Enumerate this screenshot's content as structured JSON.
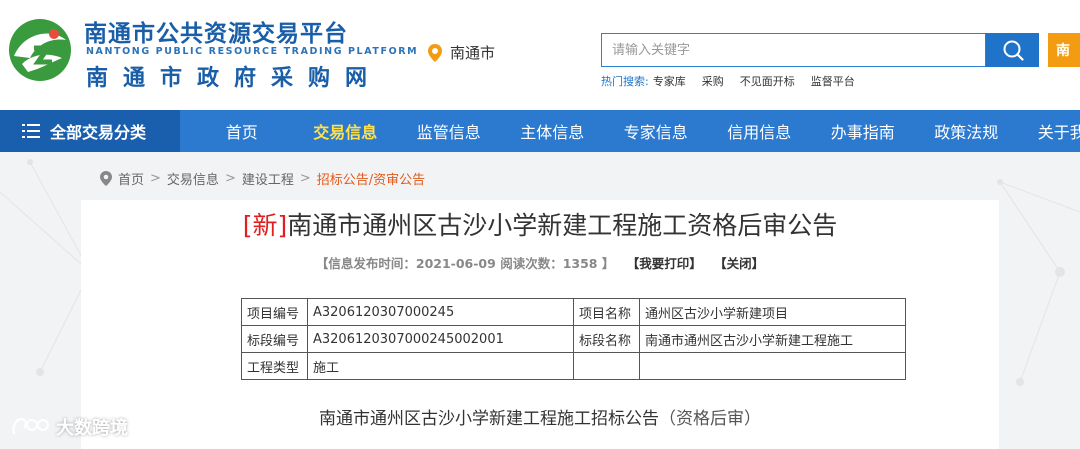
{
  "colors": {
    "brand_blue": "#1a5ea8",
    "nav_blue": "#2b7ad0",
    "nav_dark": "#1a5fae",
    "active_yellow": "#ffe04a",
    "accent_red": "#e02020",
    "accent_orange": "#f39c12",
    "breadcrumb_current": "#e05a1c"
  },
  "header": {
    "logo_icon": "nantong-logo-icon",
    "title_cn": "南通市公共资源交易平台",
    "title_en": "NANTONG PUBLIC RESOURCE TRADING PLATFORM",
    "title_cn2": "南通市政府采购网",
    "location": "南通市",
    "search": {
      "placeholder": "请输入关键字"
    },
    "orange_button": "南",
    "hot": {
      "label": "热门搜索:",
      "items": [
        "专家库",
        "采购",
        "不见面开标",
        "监督平台"
      ]
    }
  },
  "nav": {
    "category_label": "全部交易分类",
    "items": [
      {
        "label": "首页",
        "active": false
      },
      {
        "label": "交易信息",
        "active": true
      },
      {
        "label": "监管信息",
        "active": false
      },
      {
        "label": "主体信息",
        "active": false
      },
      {
        "label": "专家信息",
        "active": false
      },
      {
        "label": "信用信息",
        "active": false
      },
      {
        "label": "办事指南",
        "active": false
      },
      {
        "label": "政策法规",
        "active": false
      },
      {
        "label": "关于我们",
        "active": false
      }
    ]
  },
  "breadcrumb": {
    "items": [
      "首页",
      "交易信息",
      "建设工程"
    ],
    "current": "招标公告/资审公告",
    "separator": ">"
  },
  "article": {
    "new_tag": "[新]",
    "title": "南通市通州区古沙小学新建工程施工资格后审公告",
    "meta": {
      "open": "【",
      "publish_label": "信息发布时间：",
      "publish_date": "2021-06-09",
      "views_label": "阅读次数：",
      "views": "1358",
      "close": "】",
      "print": "【我要打印】",
      "close_btn": "【关闭】"
    },
    "table": [
      {
        "k1": "项目编号",
        "v1": "A3206120307000245",
        "k2": "项目名称",
        "v2": "通州区古沙小学新建项目"
      },
      {
        "k1": "标段编号",
        "v1": "A3206120307000245002001",
        "k2": "标段名称",
        "v2": "南通市通州区古沙小学新建工程施工"
      },
      {
        "k1": "工程类型",
        "v1": "施工",
        "k2": "",
        "v2": ""
      }
    ],
    "subtitle": "南通市通州区古沙小学新建工程施工招标公告",
    "subtitle_paren": "（资格后审）"
  },
  "watermark": "大数跨境"
}
